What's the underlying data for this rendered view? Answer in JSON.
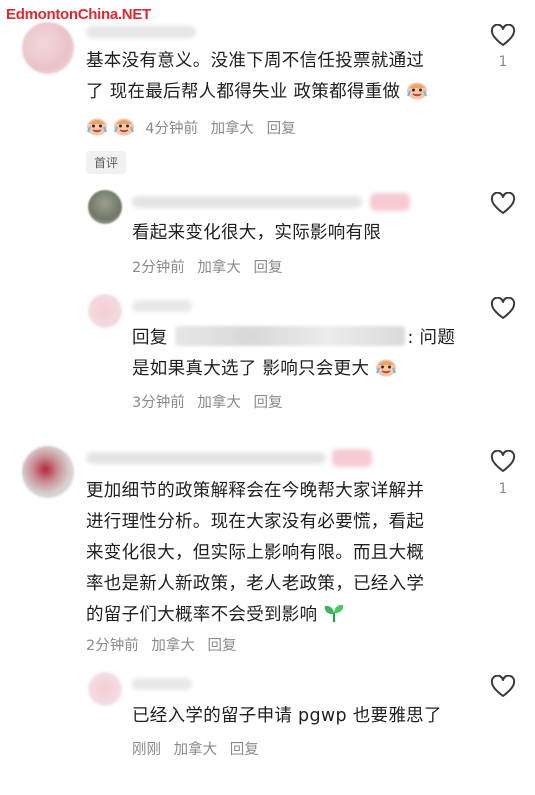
{
  "watermark": "EdmontonChina.NET",
  "comments": [
    {
      "line1": "基本没有意义。没准下周不信任投票就通过",
      "line2": "了 现在最后帮人都得失业 政策都得重做",
      "time": "4分钟前",
      "location": "加拿大",
      "reply": "回复",
      "likes": "1",
      "tag": "首评",
      "emoji": "crying-laughing-face"
    },
    {
      "line1": "看起来变化很大，实际影响有限",
      "time": "2分钟前",
      "location": "加拿大",
      "reply": "回复"
    },
    {
      "reply_prefix": "回复",
      "line1_suffix": ": 问题",
      "line2": "是如果真大选了 影响只会更大",
      "time": "3分钟前",
      "location": "加拿大",
      "reply": "回复"
    },
    {
      "line1": "更加细节的政策解释会在今晚帮大家详解并",
      "line2": "进行理性分析。现在大家没有必要慌，看起",
      "line3": "来变化很大，但实际上影响有限。而且大概",
      "line4": "率也是新人新政策，老人老政策，已经入学",
      "line5": "的留子们大概率不会受到影响",
      "time": "2分钟前",
      "location": "加拿大",
      "reply": "回复",
      "likes": "1",
      "emoji": "seedling"
    },
    {
      "line1": "已经入学的留子申请 pgwp 也要雅思了",
      "time": "刚刚",
      "location": "加拿大",
      "reply": "回复"
    }
  ],
  "colors": {
    "text": "#1f1f1f",
    "meta": "#8b8b8b",
    "watermark": "#e0282e",
    "tag_bg": "#f1f1f2"
  }
}
